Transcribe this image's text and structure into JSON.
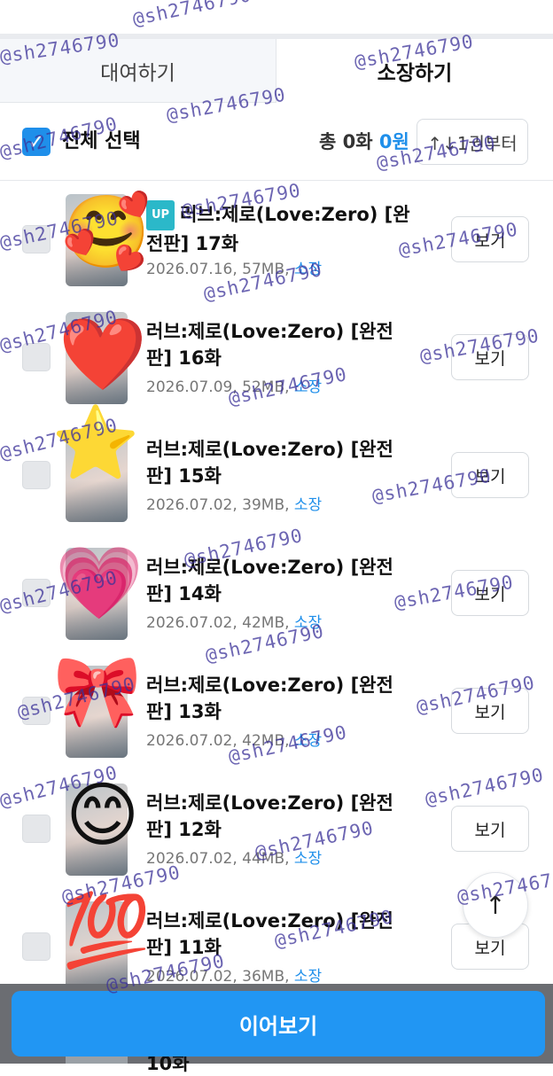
{
  "tabs": {
    "rent_label": "대여하기",
    "own_label": "소장하기"
  },
  "select_bar": {
    "select_all_label": "전체 선택",
    "total_prefix": "총 0화",
    "total_amount": "0원",
    "sort_label": "↑↓1권부터",
    "check_glyph": "✓"
  },
  "episodes": [
    {
      "badge": "UP",
      "title": "러브:제로(Love:Zero) [완전판] 17화",
      "date_size": "2026.07.16, 57MB, ",
      "status": "소장",
      "view_label": "보기",
      "sticker": "🥰"
    },
    {
      "badge": "",
      "title": "러브:제로(Love:Zero) [완전판] 16화",
      "date_size": "2026.07.09, 52MB, ",
      "status": "소장",
      "view_label": "보기",
      "sticker": "❤️"
    },
    {
      "badge": "",
      "title": "러브:제로(Love:Zero) [완전판] 15화",
      "date_size": "2026.07.02, 39MB, ",
      "status": "소장",
      "view_label": "보기",
      "sticker": "⭐"
    },
    {
      "badge": "",
      "title": "러브:제로(Love:Zero) [완전판] 14화",
      "date_size": "2026.07.02, 42MB, ",
      "status": "소장",
      "view_label": "보기",
      "sticker": "💗"
    },
    {
      "badge": "",
      "title": "러브:제로(Love:Zero) [완전판] 13화",
      "date_size": "2026.07.02, 42MB, ",
      "status": "소장",
      "view_label": "보기",
      "sticker": "🎀"
    },
    {
      "badge": "",
      "title": "러브:제로(Love:Zero) [완전판] 12화",
      "date_size": "2026.07.02, 44MB, ",
      "status": "소장",
      "view_label": "보기",
      "sticker": "😊"
    },
    {
      "badge": "",
      "title": "러브:제로(Love:Zero) [완전판] 11화",
      "date_size": "2026.07.02, 36MB, ",
      "status": "소장",
      "view_label": "보기",
      "sticker": "💯"
    }
  ],
  "next_row_peek": "10화",
  "continue_button": "이어보기",
  "scroll_top_glyph": "↑",
  "watermark": "@sh2746790",
  "colors": {
    "accent": "#2196f3",
    "owned": "#1f8fea",
    "up_badge": "#2bb8c9",
    "watermark": "#3c3299"
  }
}
